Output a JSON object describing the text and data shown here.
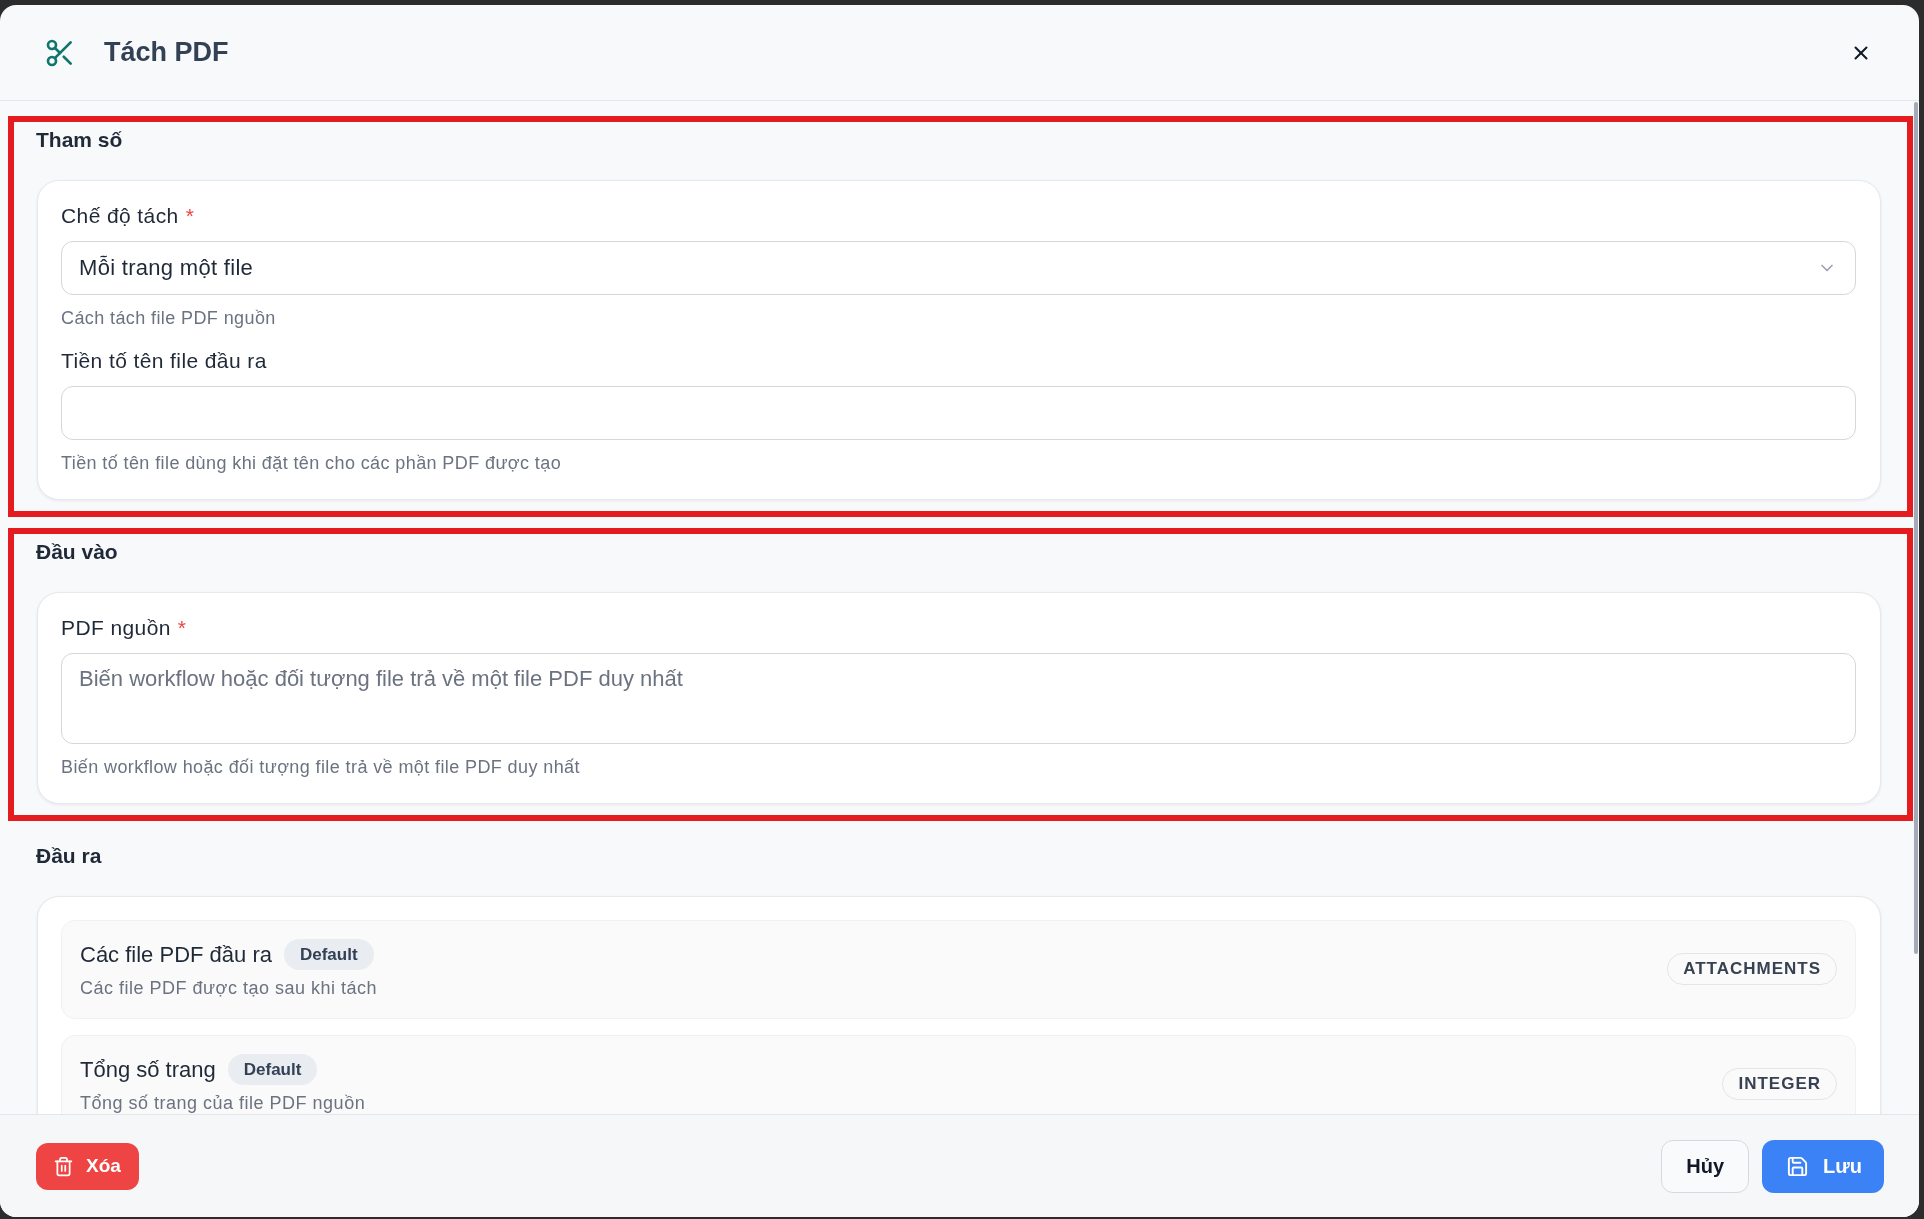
{
  "dialog": {
    "title": "Tách PDF"
  },
  "sections": [
    {
      "kind": "fields",
      "title": "Tham số",
      "highlighted": true,
      "fields": [
        {
          "kind": "select",
          "label": "Chế độ tách",
          "required_mark": "*",
          "value": "Mỗi trang một file",
          "help": "Cách tách file PDF nguồn"
        },
        {
          "kind": "text",
          "label": "Tiền tố tên file đầu ra",
          "help": "Tiền tố tên file dùng khi đặt tên cho các phần PDF được tạo"
        }
      ]
    },
    {
      "kind": "fields",
      "title": "Đầu vào",
      "highlighted": true,
      "fields": [
        {
          "kind": "textarea",
          "label": "PDF nguồn",
          "required_mark": "*",
          "placeholder": "Biến workflow hoặc đối tượng file trả về một file PDF duy nhất",
          "help": "Biến workflow hoặc đối tượng file trả về một file PDF duy nhất"
        }
      ]
    },
    {
      "kind": "outputs",
      "title": "Đầu ra",
      "highlighted": false,
      "outputs": [
        {
          "name": "Các file PDF đầu ra",
          "badge": "Default",
          "description": "Các file PDF được tạo sau khi tách",
          "type": "ATTACHMENTS"
        },
        {
          "name": "Tổng số trang",
          "badge": "Default",
          "description": "Tổng số trang của file PDF nguồn",
          "type": "INTEGER"
        }
      ]
    }
  ],
  "footer": {
    "delete_button": "Xóa",
    "cancel_button": "Hủy",
    "save_button": "Lưu"
  }
}
